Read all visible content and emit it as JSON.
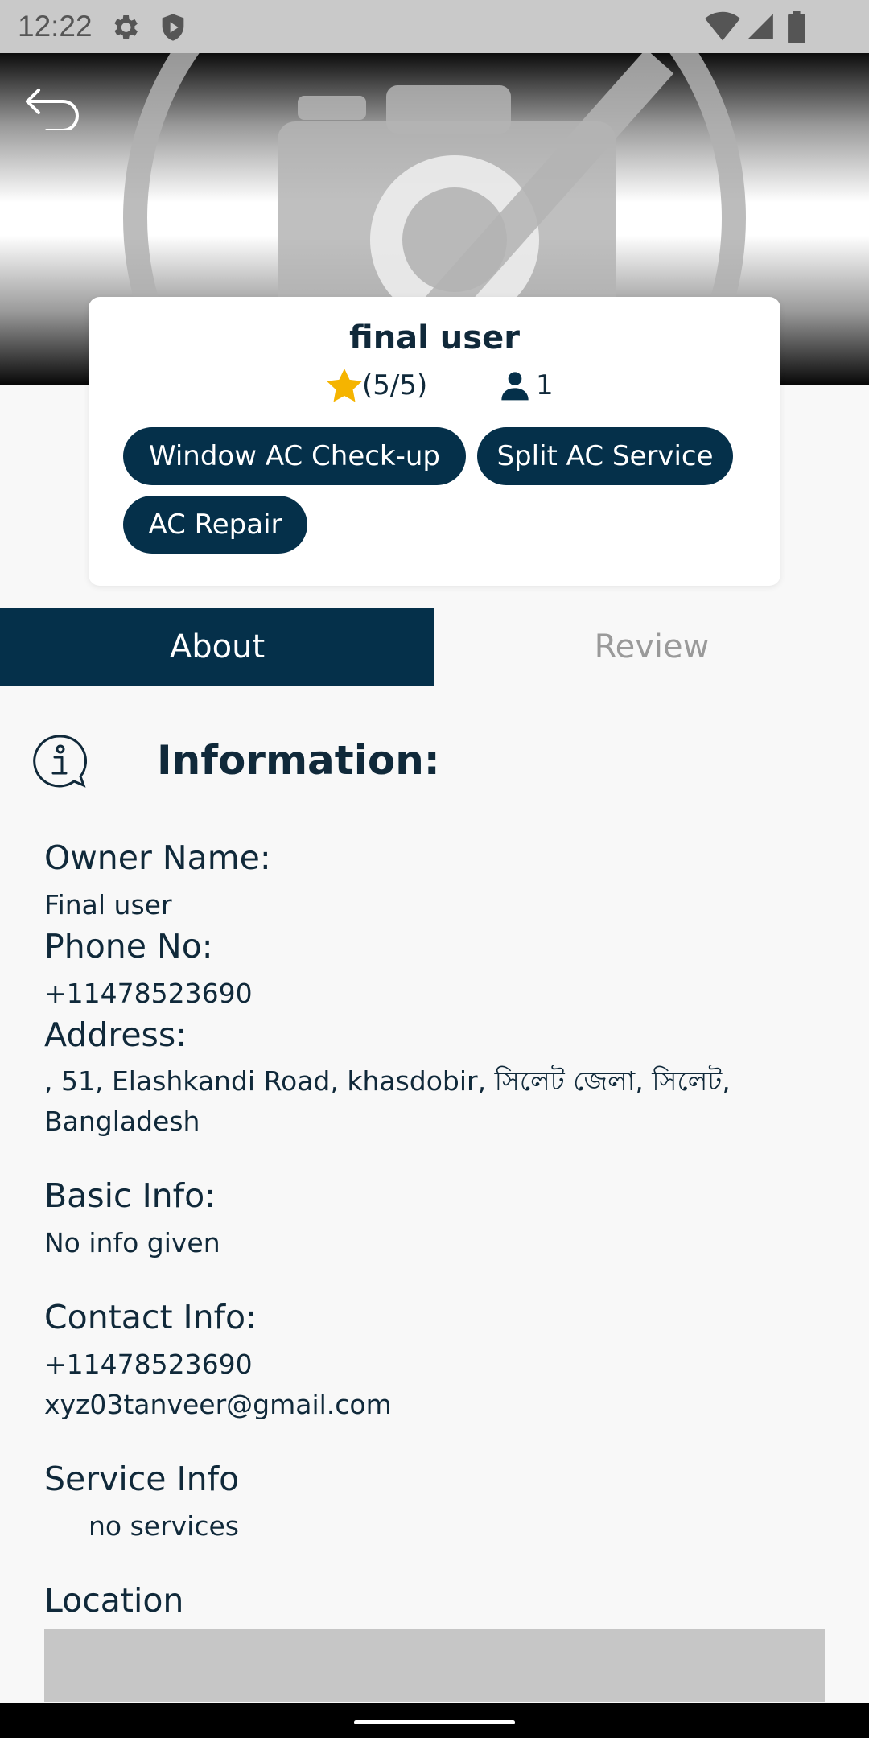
{
  "status_bar": {
    "time": "12:22"
  },
  "profile": {
    "name": "final user",
    "rating": "(5/5)",
    "customers": "1",
    "services": [
      "Window AC Check-up",
      "Split AC Service",
      "AC Repair"
    ]
  },
  "tabs": [
    {
      "label": "About"
    },
    {
      "label": "Review"
    }
  ],
  "info": {
    "title": "Information:",
    "owner_label": "Owner Name:",
    "owner_value": "Final user",
    "phone_label": "Phone No:",
    "phone_value": "+11478523690",
    "address_label": "Address:",
    "address_line1": ", 51, Elashkandi Road, khasdobir, সিলেট জেলা, সিলেট,",
    "address_line2": "Bangladesh",
    "basic_label": "Basic Info:",
    "basic_value": "No info given",
    "contact_label": "Contact Info:",
    "contact_phone": "+11478523690",
    "contact_email": "xyz03tanveer@gmail.com",
    "service_label": "Service Info",
    "service_value": "no services",
    "location_label": "Location"
  },
  "colors": {
    "primary": "#05304a",
    "star": "#f5b400",
    "text": "#10293a",
    "tab_inactive_text": "#9a9a9a"
  }
}
